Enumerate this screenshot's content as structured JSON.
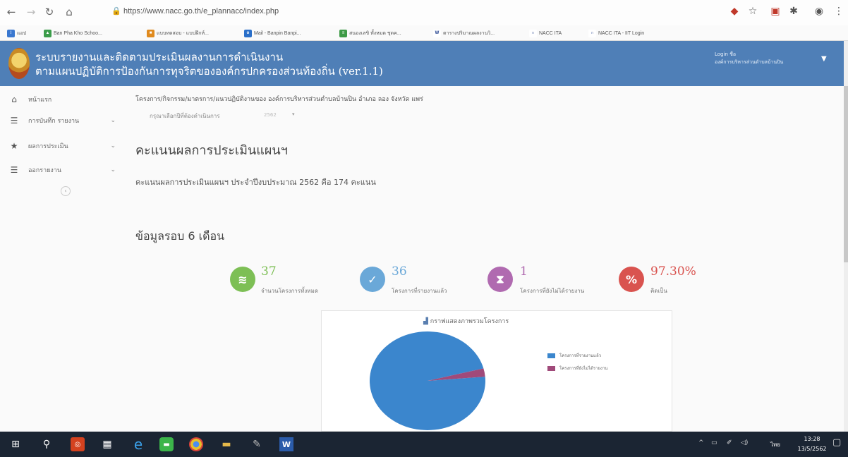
{
  "browser": {
    "url": "https://www.nacc.go.th/e_plannacc/index.php",
    "bookmarks": [
      "แอป",
      "Ban Pha Kho Schoo...",
      "แบบทดสอบ - แบบฝึกห์...",
      "Mail - Banpin Banpi...",
      "สนองเลขิ ทั้งหมด ชุดค...",
      "ตารางปริมาณผลงานวิ...",
      "NACC ITA",
      "NACC ITA - IIT Login"
    ]
  },
  "header": {
    "title_line1": "ระบบรายงานและติดตามประเมินผลงานการดำเนินงาน",
    "title_line2": "ตามแผนปฏิบัติการป้องกันการทุจริตขององค์กรปกครองส่วนท้องถิ่น (ver.1.1)",
    "login_label": "Login ชื่อ",
    "org_name": "องค์การบริหารส่วนตำบลบ้านปิน"
  },
  "sidebar": {
    "items": [
      {
        "label": "หน้าแรก"
      },
      {
        "label": "การบันทึก รายงาน"
      },
      {
        "label": "ผลการประเมิน"
      },
      {
        "label": "ออกรายงาน"
      }
    ],
    "collapse": "‹"
  },
  "main": {
    "breadcrumb": "โครงการ/กิจกรรม/มาตรการ/แนวปฏิบัติงานของ องค์การบริหารส่วนตำบลบ้านปิน อำเภอ ลอง จังหวัด แพร่",
    "year_label": "กรุณาเลือกปีที่ต้องดำเนินการ",
    "year_value": "2562",
    "section_score_title": "คะแนนผลการประเมินแผนฯ",
    "score_text": "คะแนนผลการประเมินแผนฯ ประจำปีงบประมาณ 2562 คือ 174 คะแนน",
    "section_six_month": "ข้อมูลรอบ 6 เดือน",
    "stats": [
      {
        "value": "37",
        "label": "จำนวนโครงการทั้งหมด",
        "color": "#7dbf55"
      },
      {
        "value": "36",
        "label": "โครงการที่รายงานแล้ว",
        "color": "#6aa8d8"
      },
      {
        "value": "1",
        "label": "โครงการที่ยังไม่ได้รายงาน",
        "color": "#b06ab0"
      },
      {
        "value": "97.30%",
        "label": "คิดเป็น",
        "color": "#d9534f"
      }
    ]
  },
  "chart_data": {
    "type": "pie",
    "title": "กราฟแสดงภาพรวมโครงการ",
    "categories": [
      "โครงการที่รายงานแล้ว",
      "โครงการที่ยังไม่ได้รายงาน"
    ],
    "values": [
      36,
      1
    ],
    "colors": [
      "#3b86cd",
      "#a04a7a"
    ],
    "legend": "right"
  },
  "taskbar": {
    "lang": "ไทย",
    "time": "13:28",
    "date": "13/5/2562"
  }
}
